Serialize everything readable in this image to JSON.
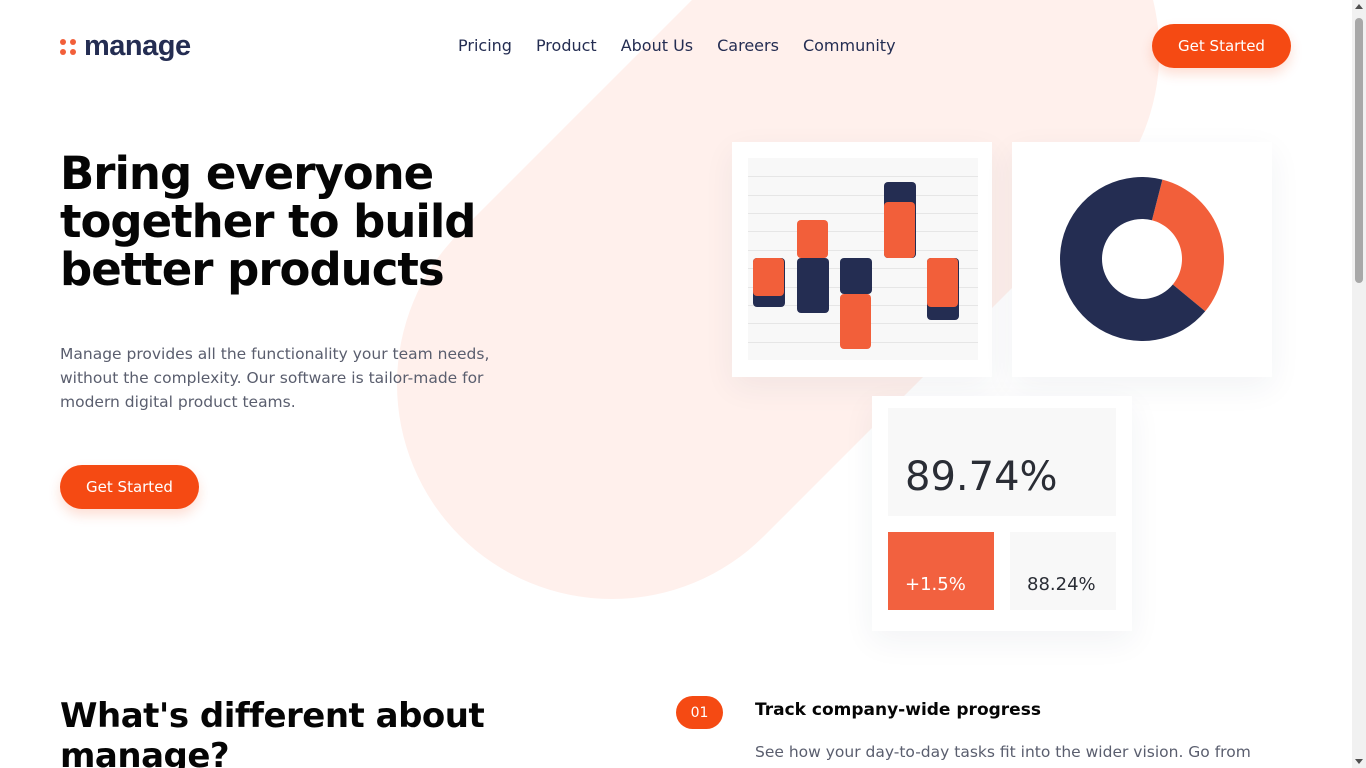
{
  "logo": {
    "text": "manage",
    "accent_color": "#f25f3a"
  },
  "nav": {
    "items": [
      "Pricing",
      "Product",
      "About Us",
      "Careers",
      "Community"
    ]
  },
  "header": {
    "cta_label": "Get Started"
  },
  "hero": {
    "title": "Bring everyone together to build better products",
    "description": "Manage provides all the functionality your team needs, without the complexity. Our software is tailor-made for modern digital product teams.",
    "cta_label": "Get Started"
  },
  "stats": {
    "main_value": "89.74%",
    "change_value": "+1.5%",
    "secondary_value": "88.24%"
  },
  "different": {
    "title": "What's different about manage?"
  },
  "feature": {
    "number": "01",
    "title": "Track company-wide progress",
    "description": "See how your day-to-day tasks fit into the wider vision. Go from"
  },
  "colors": {
    "orange": "#f25f3a",
    "navy": "#242d52",
    "cta": "#f54a13",
    "pill_bg": "#fff0ec"
  },
  "chart_data": [
    {
      "type": "bar",
      "columns": [
        {
          "navy": [
            -2.7,
            0
          ],
          "orange": [
            -2.1,
            0
          ]
        },
        {
          "navy": [
            -3,
            0
          ],
          "orange": [
            0,
            2.1
          ]
        },
        {
          "navy": [
            -2,
            0
          ],
          "orange": [
            -5,
            -2
          ]
        },
        {
          "navy": [
            0,
            4.2
          ],
          "orange": [
            0,
            3.1
          ]
        },
        {
          "navy": [
            -3.4,
            0
          ],
          "orange": [
            -2.7,
            0
          ]
        }
      ],
      "ylim": [
        -5.6,
        5.5
      ],
      "grid": true
    },
    {
      "type": "pie",
      "donut": true,
      "slices": [
        {
          "value": 32,
          "color": "#f25f3a"
        },
        {
          "value": 68,
          "color": "#242d52"
        }
      ]
    }
  ]
}
